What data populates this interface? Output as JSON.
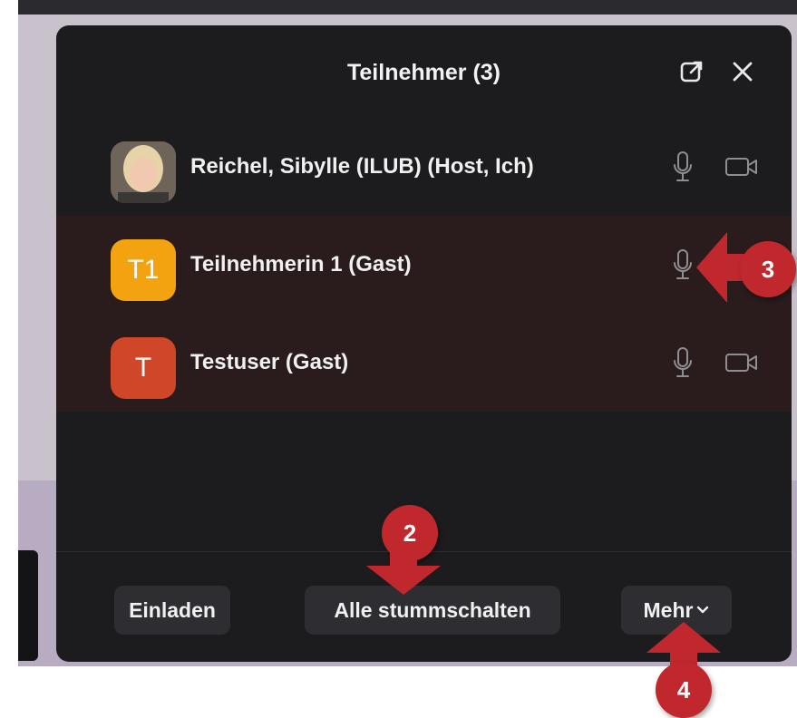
{
  "panel": {
    "title": "Teilnehmer (3)"
  },
  "participants": [
    {
      "name": "Reichel, Sibylle (ILUB) (Host, Ich)",
      "avatar_text": "",
      "avatar_color": "#8a7a6a",
      "mic": "mic-icon",
      "video": "video-icon"
    },
    {
      "name": "Teilnehmerin 1 (Gast)",
      "avatar_text": "T1",
      "avatar_color": "#f2a30f",
      "mic": "mic-icon"
    },
    {
      "name": "Testuser (Gast)",
      "avatar_text": "T",
      "avatar_color": "#cf4728",
      "mic": "mic-icon",
      "video": "video-icon"
    }
  ],
  "footer": {
    "invite": "Einladen",
    "mute_all": "Alle stummschalten",
    "more": "Mehr"
  },
  "callouts": {
    "two": "2",
    "three": "3",
    "four": "4"
  },
  "colors": {
    "panel_bg": "#1c1c1f",
    "selected_row_bg": "#2a1b1d",
    "button_bg": "#2e2e32",
    "callout_red": "#c0282e"
  }
}
